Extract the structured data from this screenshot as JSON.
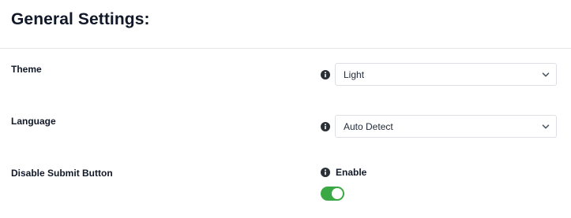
{
  "page": {
    "title": "General Settings:"
  },
  "settings": {
    "theme": {
      "label": "Theme",
      "value": "Light",
      "icon": "info-icon"
    },
    "language": {
      "label": "Language",
      "value": "Auto Detect",
      "icon": "info-icon"
    },
    "disable_submit": {
      "label": "Disable Submit Button",
      "toggle_label": "Enable",
      "enabled": true,
      "icon": "info-icon"
    }
  },
  "colors": {
    "toggle_on": "#3aa845",
    "text": "#111827",
    "border": "#dcdfe4"
  }
}
